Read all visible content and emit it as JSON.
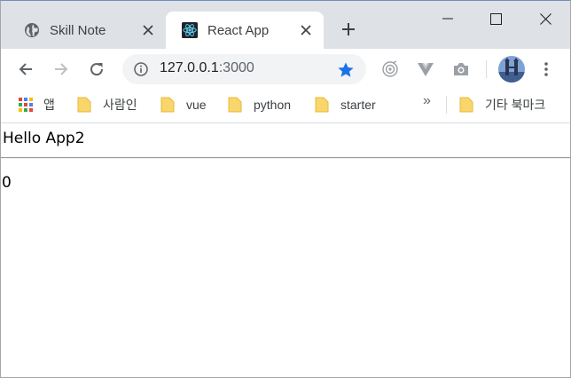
{
  "tabs": [
    {
      "title": "Skill Note",
      "icon": "globe-icon",
      "active": false
    },
    {
      "title": "React App",
      "icon": "react-logo-icon",
      "active": true
    }
  ],
  "omnibox": {
    "host": "127.0.0.1",
    "port": ":3000"
  },
  "bookmarks": {
    "apps_label": "앱",
    "items": [
      "사람인",
      "vue",
      "python",
      "starter"
    ],
    "overflow": "»",
    "other_label": "기타 북마크"
  },
  "page": {
    "title": "Hello App2",
    "count": "0"
  },
  "colors": {
    "tabstrip": "#dee1e6",
    "accent": "#1a73e8",
    "react": "#61dafb",
    "folder": "#f9d66c"
  }
}
